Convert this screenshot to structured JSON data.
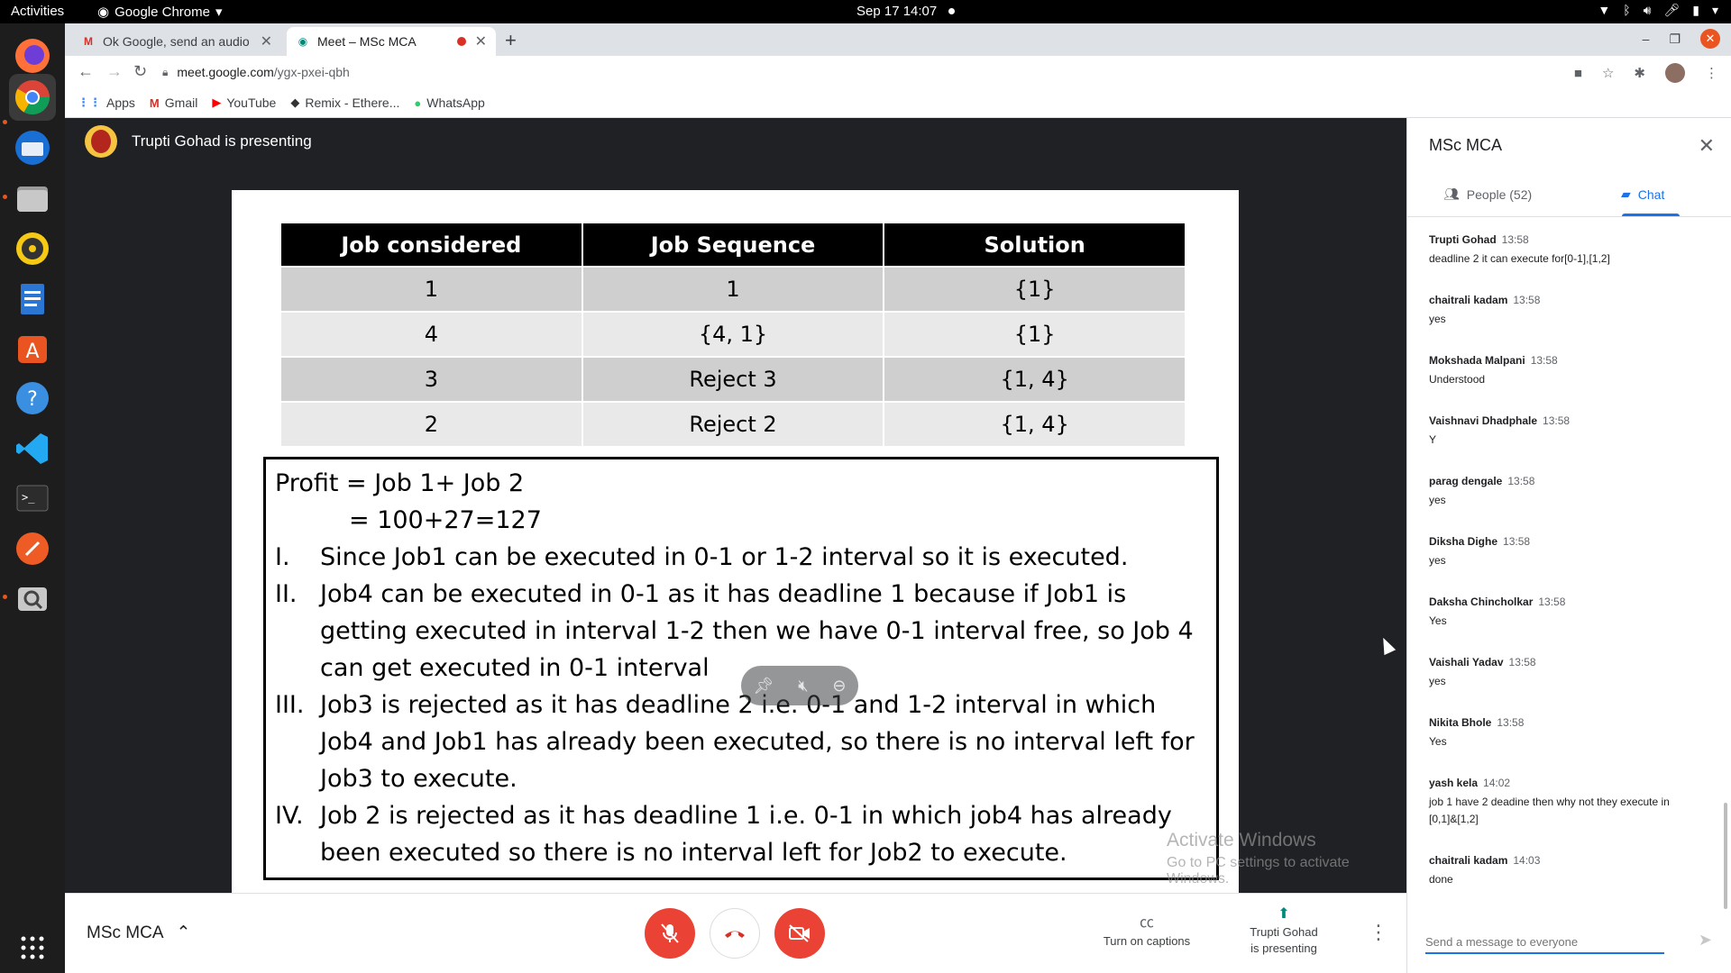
{
  "os": {
    "activities": "Activities",
    "app_name": "Google Chrome",
    "clock": "Sep 17  14:07"
  },
  "browser": {
    "tabs": [
      {
        "title": "Ok Google, send an audio",
        "active": false
      },
      {
        "title": "Meet – MSc MCA",
        "active": true
      }
    ],
    "url_host": "meet.google.com",
    "url_path": "/ygx-pxei-qbh",
    "bookmarks": [
      "Apps",
      "Gmail",
      "YouTube",
      "Remix - Ethere...",
      "WhatsApp"
    ]
  },
  "meet": {
    "presenting_banner": "Trupti Gohad is presenting",
    "meeting_name": "MSc MCA",
    "captions_label": "Turn on captions",
    "presenting_label_1": "Trupti Gohad",
    "presenting_label_2": "is presenting"
  },
  "slide": {
    "table": {
      "headers": [
        "Job considered",
        "Job Sequence",
        "Solution"
      ],
      "rows": [
        [
          "1",
          "1",
          "{1}"
        ],
        [
          "4",
          "{4, 1}",
          "{1}"
        ],
        [
          "3",
          "Reject 3",
          "{1, 4}"
        ],
        [
          "2",
          "Reject 2",
          "{1, 4}"
        ]
      ]
    },
    "profit_line": "Profit = Job 1+ Job 2",
    "profit_result": "=  100+27=127",
    "points": [
      {
        "num": "I.",
        "text": "Since Job1 can be executed in 0-1 or 1-2 interval so it is executed."
      },
      {
        "num": "II.",
        "text": "Job4 can be executed in 0-1 as it has deadline 1 because if Job1 is getting executed in interval 1-2 then we have 0-1 interval free, so Job 4 can get executed in 0-1 interval"
      },
      {
        "num": "III.",
        "text": "Job3 is rejected as it has deadline 2 i.e. 0-1 and 1-2 interval in which Job4 and Job1 has already been executed, so there is no interval left for Job3 to execute."
      },
      {
        "num": "IV.",
        "text": "Job 2 is rejected as it has deadline 1 i.e. 0-1 in which job4 has already been executed so there is no interval left for Job2 to execute."
      }
    ]
  },
  "watermark": {
    "line1": "Activate Windows",
    "line2": "Go to PC settings to activate Windows."
  },
  "panel": {
    "title": "MSc MCA",
    "people_tab": "People (52)",
    "chat_tab": "Chat",
    "messages": [
      {
        "sender": "Trupti Gohad",
        "time": "13:58",
        "text": "deadline 2 it can execute for[0-1],[1,2]"
      },
      {
        "sender": "chaitrali kadam",
        "time": "13:58",
        "text": "yes"
      },
      {
        "sender": "Mokshada Malpani",
        "time": "13:58",
        "text": "Understood"
      },
      {
        "sender": "Vaishnavi Dhadphale",
        "time": "13:58",
        "text": "Y"
      },
      {
        "sender": "parag dengale",
        "time": "13:58",
        "text": "yes"
      },
      {
        "sender": "Diksha Dighe",
        "time": "13:58",
        "text": "yes"
      },
      {
        "sender": "Daksha Chincholkar",
        "time": "13:58",
        "text": "Yes"
      },
      {
        "sender": "Vaishali Yadav",
        "time": "13:58",
        "text": "yes"
      },
      {
        "sender": "Nikita Bhole",
        "time": "13:58",
        "text": "Yes"
      },
      {
        "sender": "yash kela",
        "time": "14:02",
        "text": "job 1 have 2 deadine then why not they execute in [0,1]&[1,2]"
      },
      {
        "sender": "chaitrali kadam",
        "time": "14:03",
        "text": "done"
      }
    ],
    "compose_placeholder": "Send a message to everyone"
  }
}
